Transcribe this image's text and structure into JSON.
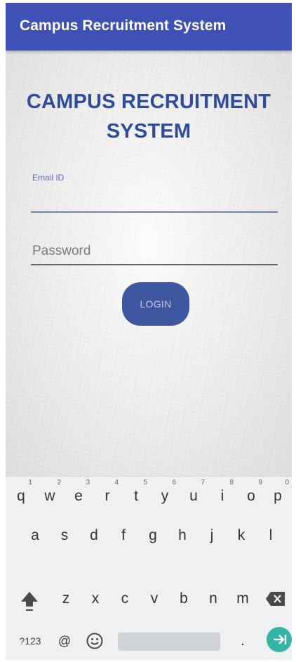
{
  "app_bar": {
    "title": "Campus Recruitment System",
    "color": "#3f51b5"
  },
  "login_form": {
    "heading_line1": "CAMPUS RECRUITMENT",
    "heading_line2": "SYSTEM",
    "email_label": "Email ID",
    "email_value": "",
    "password_hint": "Password",
    "login_button": "LOGIN",
    "accent_color": "#2f4b9a"
  },
  "keyboard": {
    "row1": [
      {
        "key": "q",
        "hint": "1"
      },
      {
        "key": "w",
        "hint": "2"
      },
      {
        "key": "e",
        "hint": "3"
      },
      {
        "key": "r",
        "hint": "4"
      },
      {
        "key": "t",
        "hint": "5"
      },
      {
        "key": "y",
        "hint": "6"
      },
      {
        "key": "u",
        "hint": "7"
      },
      {
        "key": "i",
        "hint": "8"
      },
      {
        "key": "o",
        "hint": "9"
      },
      {
        "key": "p",
        "hint": "0"
      }
    ],
    "row2": [
      "a",
      "s",
      "d",
      "f",
      "g",
      "h",
      "j",
      "k",
      "l"
    ],
    "row3": [
      "z",
      "x",
      "c",
      "v",
      "b",
      "n",
      "m"
    ],
    "symbols_key": "?123",
    "at_key": "@",
    "period_key": ".",
    "shift_icon": "shift-arrow-icon",
    "backspace_icon": "backspace-icon",
    "emoji_icon": "smiley-icon",
    "enter_icon": "next-arrow-icon",
    "enter_color": "#34b4a4"
  }
}
